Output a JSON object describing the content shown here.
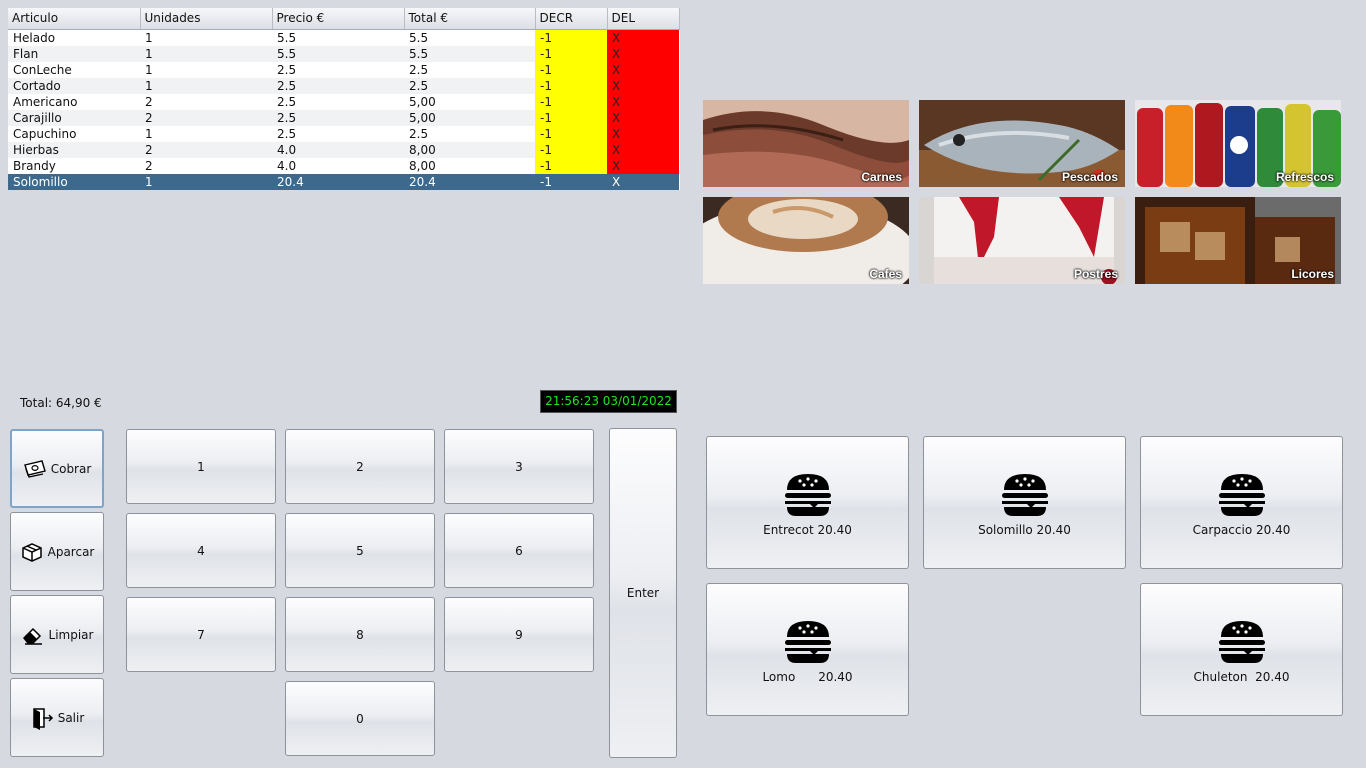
{
  "table": {
    "headers": [
      "Articulo",
      "Unidades",
      "Precio €",
      "Total €",
      "DECR",
      "DEL"
    ],
    "rows": [
      {
        "articulo": "Helado",
        "unidades": "1",
        "precio": "5.5",
        "total": "5.5",
        "decr": "-1",
        "del": "X"
      },
      {
        "articulo": "Flan",
        "unidades": "1",
        "precio": "5.5",
        "total": "5.5",
        "decr": "-1",
        "del": "X"
      },
      {
        "articulo": "ConLeche",
        "unidades": "1",
        "precio": "2.5",
        "total": "2.5",
        "decr": "-1",
        "del": "X"
      },
      {
        "articulo": "Cortado",
        "unidades": "1",
        "precio": "2.5",
        "total": "2.5",
        "decr": "-1",
        "del": "X"
      },
      {
        "articulo": "Americano",
        "unidades": "2",
        "precio": "2.5",
        "total": "5,00",
        "decr": "-1",
        "del": "X"
      },
      {
        "articulo": "Carajillo",
        "unidades": "2",
        "precio": "2.5",
        "total": "5,00",
        "decr": "-1",
        "del": "X"
      },
      {
        "articulo": "Capuchino",
        "unidades": "1",
        "precio": "2.5",
        "total": "2.5",
        "decr": "-1",
        "del": "X"
      },
      {
        "articulo": "Hierbas",
        "unidades": "2",
        "precio": "4.0",
        "total": "8,00",
        "decr": "-1",
        "del": "X"
      },
      {
        "articulo": "Brandy",
        "unidades": "2",
        "precio": "4.0",
        "total": "8,00",
        "decr": "-1",
        "del": "X"
      },
      {
        "articulo": "Solomillo",
        "unidades": "1",
        "precio": "20.4",
        "total": "20.4",
        "decr": "-1",
        "del": "X"
      }
    ],
    "selected_row": 9
  },
  "categories": [
    {
      "label": "Carnes",
      "icon": "meat-photo"
    },
    {
      "label": "Pescados",
      "icon": "fish-photo"
    },
    {
      "label": "Refrescos",
      "icon": "soda-bottles-photo"
    },
    {
      "label": "Cafes",
      "icon": "coffee-cup-photo"
    },
    {
      "label": "Postres",
      "icon": "dessert-photo"
    },
    {
      "label": "Licores",
      "icon": "liquor-glass-photo"
    }
  ],
  "total_label": "Total: 64,90 €",
  "clock": "21:56:23  03/01/2022",
  "side_buttons": {
    "cobrar": {
      "label": "Cobrar",
      "icon": "cash-icon"
    },
    "aparcar": {
      "label": "Aparcar",
      "icon": "box-icon"
    },
    "limpiar": {
      "label": "Limpiar",
      "icon": "eraser-icon"
    },
    "salir": {
      "label": "Salir",
      "icon": "exit-door-icon"
    }
  },
  "keypad": {
    "k1": "1",
    "k2": "2",
    "k3": "3",
    "k4": "4",
    "k5": "5",
    "k6": "6",
    "k7": "7",
    "k8": "8",
    "k9": "9",
    "k0": "0",
    "enter": "Enter"
  },
  "products": [
    {
      "label": "Entrecot 20.40",
      "icon": "burger-icon"
    },
    {
      "label": "Solomillo 20.40",
      "icon": "burger-icon"
    },
    {
      "label": "Carpaccio 20.40",
      "icon": "burger-icon"
    },
    {
      "label": "Lomo      20.40",
      "icon": "burger-icon"
    },
    {
      "label": "Chuleton  20.40",
      "icon": "burger-icon"
    }
  ],
  "colors": {
    "decr_bg": "#ffff00",
    "del_bg": "#ff0000",
    "selected_row_bg": "#3d6a8c",
    "clock_fg": "#21e321"
  }
}
